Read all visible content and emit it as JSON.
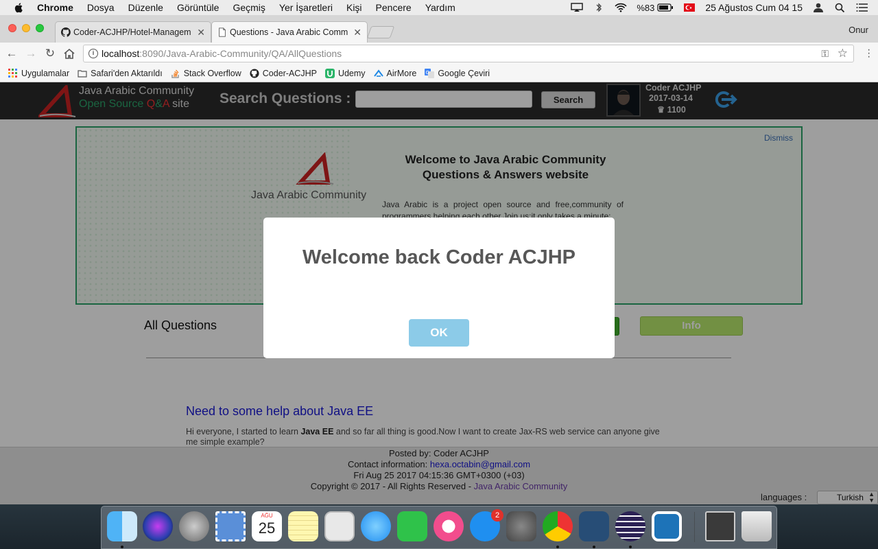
{
  "menubar": {
    "app": "Chrome",
    "items": [
      "Dosya",
      "Düzenle",
      "Görüntüle",
      "Geçmiş",
      "Yer İşaretleri",
      "Kişi",
      "Pencere",
      "Yardım"
    ],
    "battery": "%83",
    "clock": "25 Ağustos Cum  04 15"
  },
  "browser": {
    "tabs": [
      {
        "title": "Coder-ACJHP/Hotel-Managem",
        "active": false
      },
      {
        "title": "Questions - Java Arabic Comm",
        "active": true
      }
    ],
    "profile": "Onur",
    "url_host": "localhost",
    "url_rest": ":8090/Java-Arabic-Community/QA/AllQuestions",
    "bookmarks": [
      "Uygulamalar",
      "Safari'den Aktarıldı",
      "Stack Overflow",
      "Coder-ACJHP",
      "Udemy",
      "AirMore",
      "Google Çeviri"
    ]
  },
  "header": {
    "site_title": "Java Arabic Community",
    "site_sub_open": "Open Source ",
    "site_sub_q": "Q",
    "site_sub_amp": "&",
    "site_sub_a": "A",
    "site_sub_site": " site",
    "search_label": "Search Questions :",
    "search_button": "Search",
    "user_name": "Coder ACJHP",
    "user_date": "2017-03-14",
    "user_points": "♛ 1100"
  },
  "welcome": {
    "dismiss": "Dismiss",
    "logo_text": "Java Arabic Community",
    "title_line1": "Welcome to Java Arabic Community",
    "title_line2": "Questions & Answers website",
    "text": "Java Arabic is a project open source and free,community of programmers helping each other.Join us;it only takes a minute:"
  },
  "content": {
    "all_questions": "All Questions",
    "info_button": "Info"
  },
  "question": {
    "title": "Need to some help about Java EE",
    "body_start": "Hi everyone, I started to learn ",
    "body_bold": "Java EE",
    "body_end": " and so far all thing is good.Now I want to create Jax-RS web service can anyone give me simple example?"
  },
  "footer": {
    "posted_by": "Posted by: Coder ACJHP",
    "contact_label": "Contact information: ",
    "contact_email": "hexa.octabin@gmail.com",
    "date": "Fri Aug 25 2017 04:15:36 GMT+0300 (+03)",
    "copyright": "Copyright © 2017 - All Rights Reserved - ",
    "brand": "Java Arabic Community",
    "languages_label": "languages :",
    "language_selected": "Turkish"
  },
  "modal": {
    "title": "Welcome back Coder ACJHP",
    "ok": "OK"
  },
  "dock": {
    "calendar_month": "AĞU",
    "calendar_day": "25",
    "appstore_badge": "2"
  },
  "colors": {
    "accent_green": "#2aa36a",
    "header_bg": "#2b2b2b",
    "link_blue": "#1a1ad6",
    "ok_button": "#8ccbe8"
  }
}
